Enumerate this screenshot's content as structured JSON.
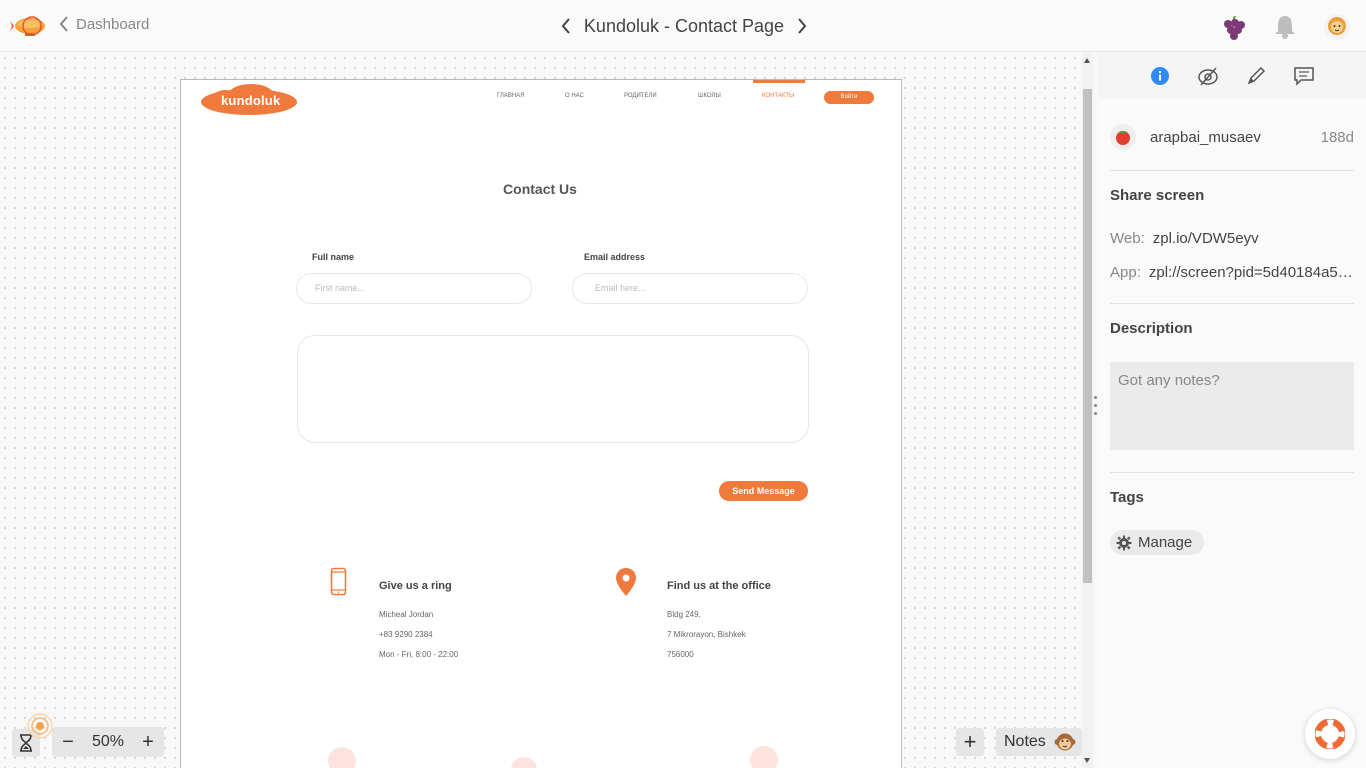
{
  "topbar": {
    "back_label": "Dashboard",
    "title": "Kundoluk - Contact Page"
  },
  "artboard": {
    "logo": "kundoluk",
    "nav": [
      "ГЛАВНАЯ",
      "О НАС",
      "РОДИТЕЛИ",
      "ШКОЛЫ",
      "КОНТАКТЫ"
    ],
    "login": "Войти",
    "heading": "Contact Us",
    "fullname_label": "Full name",
    "fullname_placeholder": "First name...",
    "email_label": "Email address",
    "email_placeholder": "Email here...",
    "send": "Send Message",
    "ring": {
      "title": "Give us a ring",
      "lines": [
        "Micheal Jordan",
        "+83 9290 2384",
        "Mon - Fri, 8:00 - 22:00"
      ]
    },
    "office": {
      "title": "Find us at the office",
      "lines": [
        "Bldg 249,",
        "7 Mikrorayon, Bishkek",
        "756000"
      ]
    }
  },
  "panel": {
    "tabs": [
      "info-icon",
      "eye-slash-icon",
      "pen-icon",
      "comment-icon"
    ],
    "user": {
      "name": "arapbai_musaev",
      "age": "188d"
    },
    "share_title": "Share screen",
    "web_key": "Web:",
    "web_val": "zpl.io/VDW5eyv",
    "app_key": "App:",
    "app_val": "zpl://screen?pid=5d40184a5f...",
    "desc_title": "Description",
    "desc_placeholder": "Got any notes?",
    "tags_title": "Tags",
    "manage": "Manage"
  },
  "bottom": {
    "zoom": "50%",
    "zoom_minus": "−",
    "zoom_plus": "+",
    "add": "+",
    "notes": "Notes"
  },
  "colors": {
    "accent": "#ef7a3c",
    "info_blue": "#2f8cf5"
  }
}
